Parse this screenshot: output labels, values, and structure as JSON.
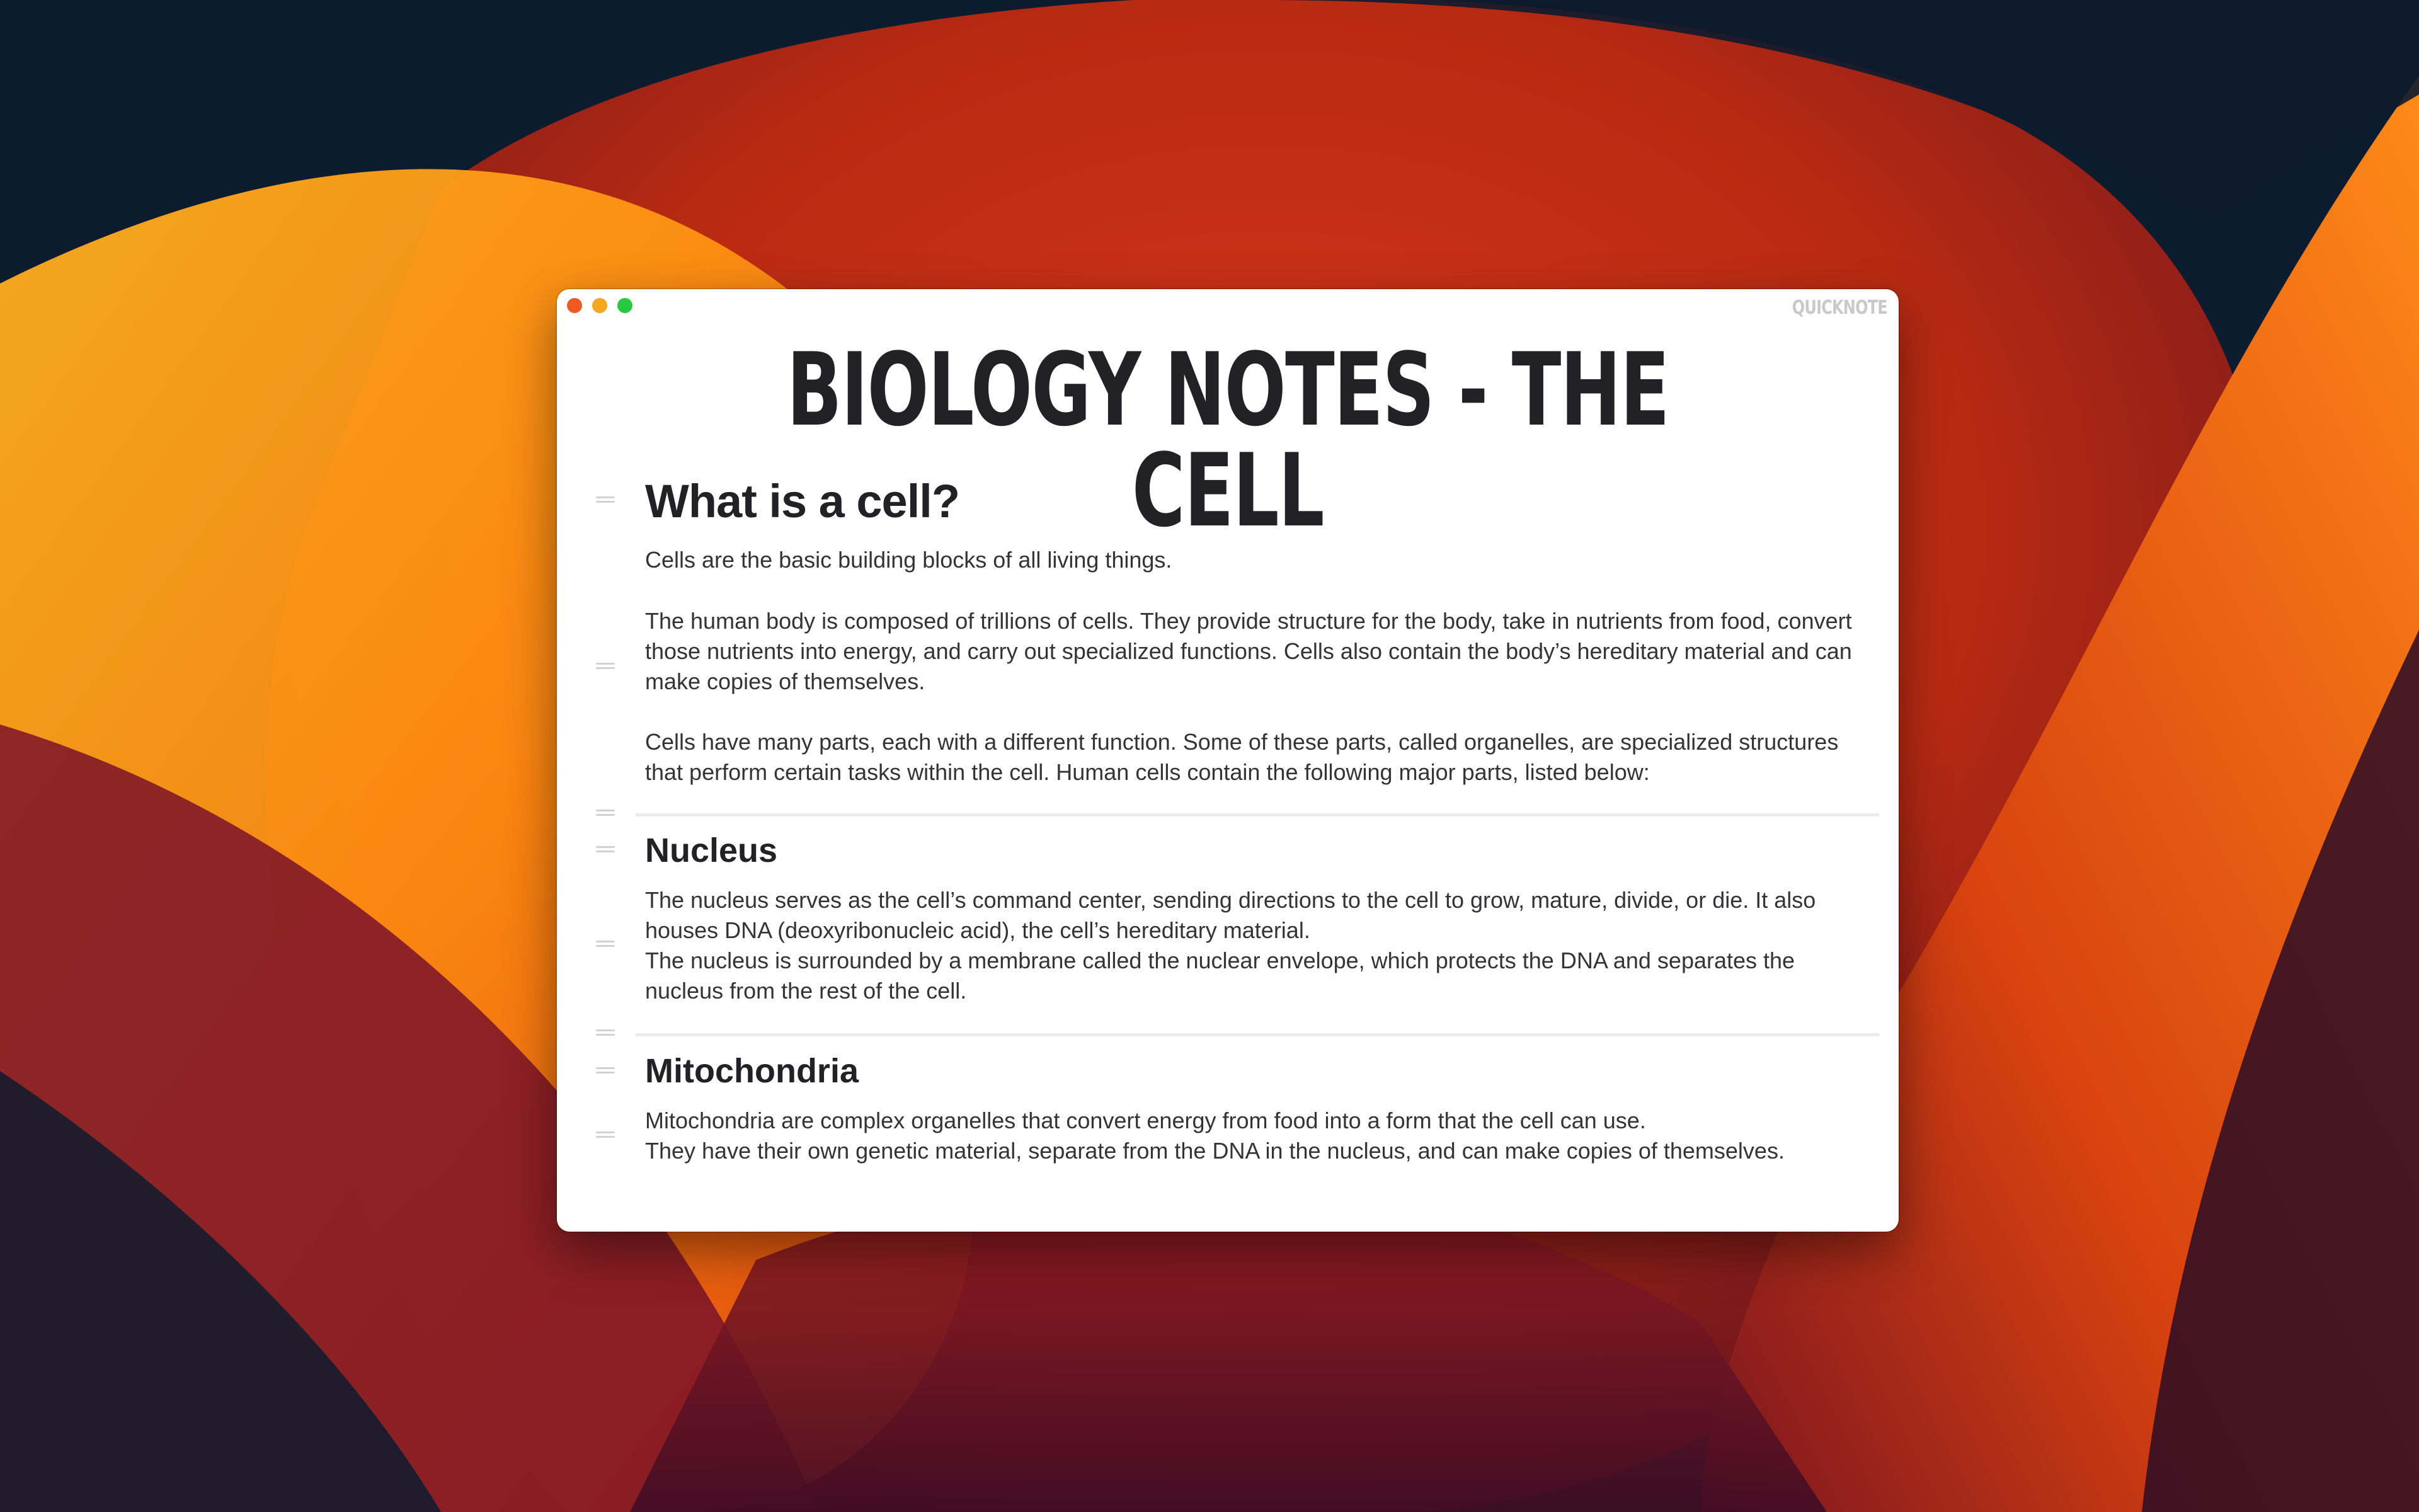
{
  "app": {
    "name": "QUICKNOTE",
    "accent_colors": {
      "close": "#ee5a24",
      "minimize": "#f5a623",
      "maximize": "#28c840"
    }
  },
  "document": {
    "title": "BIOLOGY NOTES - THE CELL",
    "sections": [
      {
        "heading": "What is a cell?",
        "paragraphs": [
          "Cells are the basic building blocks of all living things.",
          "The human body is composed of trillions of cells. They provide structure for the body, take in nutrients from food, convert those nutrients into energy, and carry out specialized functions. Cells also contain the body’s hereditary material and can make copies of themselves.",
          "Cells have many parts, each with a different function. Some of these parts, called organelles, are specialized structures that perform certain tasks within the cell. Human cells contain the following major parts, listed below:"
        ]
      },
      {
        "heading": "Nucleus",
        "paragraphs": [
          "The nucleus serves as the cell’s command center, sending directions to the cell to grow, mature, divide, or die. It also houses DNA (deoxyribonucleic acid), the cell’s hereditary material.",
          "The nucleus is surrounded by a membrane called the nuclear envelope, which protects the DNA and separates the nucleus from the rest of the cell."
        ]
      },
      {
        "heading": "Mitochondria",
        "paragraphs": [
          "Mitochondria are complex organelles that convert energy from food into a form that the cell can use.",
          "They have their own genetic material, separate from the DNA in the nucleus, and can make copies of themselves."
        ]
      }
    ]
  }
}
